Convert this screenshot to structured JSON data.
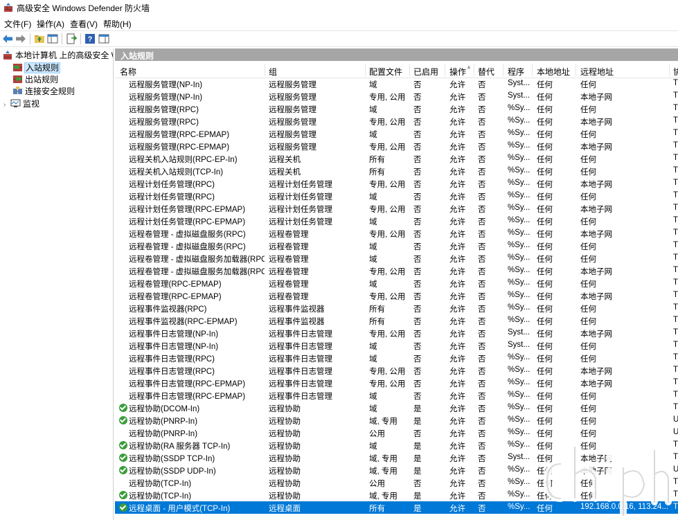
{
  "window": {
    "title": "高级安全 Windows Defender 防火墙"
  },
  "menu": [
    "文件(F)",
    "操作(A)",
    "查看(V)",
    "帮助(H)"
  ],
  "tree": [
    {
      "label": "本地计算机 上的高级安全 Wind"
    },
    {
      "label": "入站规则"
    },
    {
      "label": "出站规则"
    },
    {
      "label": "连接安全规则"
    },
    {
      "label": "监视"
    }
  ],
  "panel": {
    "title": "入站规则"
  },
  "columns": [
    "名称",
    "组",
    "配置文件",
    "已启用",
    "操作",
    "替代",
    "程序",
    "本地地址",
    "远程地址",
    "协"
  ],
  "rows": [
    {
      "name": "远程服务管理(NP-In)",
      "group": "远程服务管理",
      "profile": "域",
      "enabled": "否",
      "action": "允许",
      "override": "否",
      "program": "Syst...",
      "local": "任何",
      "remote": "任何",
      "more": "T",
      "on": false
    },
    {
      "name": "远程服务管理(NP-In)",
      "group": "远程服务管理",
      "profile": "专用, 公用",
      "enabled": "否",
      "action": "允许",
      "override": "否",
      "program": "Syst...",
      "local": "任何",
      "remote": "本地子网",
      "more": "T",
      "on": false
    },
    {
      "name": "远程服务管理(RPC)",
      "group": "远程服务管理",
      "profile": "域",
      "enabled": "否",
      "action": "允许",
      "override": "否",
      "program": "%Sy...",
      "local": "任何",
      "remote": "任何",
      "more": "T",
      "on": false
    },
    {
      "name": "远程服务管理(RPC)",
      "group": "远程服务管理",
      "profile": "专用, 公用",
      "enabled": "否",
      "action": "允许",
      "override": "否",
      "program": "%Sy...",
      "local": "任何",
      "remote": "本地子网",
      "more": "T",
      "on": false
    },
    {
      "name": "远程服务管理(RPC-EPMAP)",
      "group": "远程服务管理",
      "profile": "域",
      "enabled": "否",
      "action": "允许",
      "override": "否",
      "program": "%Sy...",
      "local": "任何",
      "remote": "任何",
      "more": "T",
      "on": false
    },
    {
      "name": "远程服务管理(RPC-EPMAP)",
      "group": "远程服务管理",
      "profile": "专用, 公用",
      "enabled": "否",
      "action": "允许",
      "override": "否",
      "program": "%Sy...",
      "local": "任何",
      "remote": "本地子网",
      "more": "T",
      "on": false
    },
    {
      "name": "远程关机入站规则(RPC-EP-In)",
      "group": "远程关机",
      "profile": "所有",
      "enabled": "否",
      "action": "允许",
      "override": "否",
      "program": "%Sy...",
      "local": "任何",
      "remote": "任何",
      "more": "T",
      "on": false
    },
    {
      "name": "远程关机入站规则(TCP-In)",
      "group": "远程关机",
      "profile": "所有",
      "enabled": "否",
      "action": "允许",
      "override": "否",
      "program": "%Sy...",
      "local": "任何",
      "remote": "任何",
      "more": "T",
      "on": false
    },
    {
      "name": "远程计划任务管理(RPC)",
      "group": "远程计划任务管理",
      "profile": "专用, 公用",
      "enabled": "否",
      "action": "允许",
      "override": "否",
      "program": "%Sy...",
      "local": "任何",
      "remote": "本地子网",
      "more": "T",
      "on": false
    },
    {
      "name": "远程计划任务管理(RPC)",
      "group": "远程计划任务管理",
      "profile": "域",
      "enabled": "否",
      "action": "允许",
      "override": "否",
      "program": "%Sy...",
      "local": "任何",
      "remote": "任何",
      "more": "T",
      "on": false
    },
    {
      "name": "远程计划任务管理(RPC-EPMAP)",
      "group": "远程计划任务管理",
      "profile": "专用, 公用",
      "enabled": "否",
      "action": "允许",
      "override": "否",
      "program": "%Sy...",
      "local": "任何",
      "remote": "本地子网",
      "more": "T",
      "on": false
    },
    {
      "name": "远程计划任务管理(RPC-EPMAP)",
      "group": "远程计划任务管理",
      "profile": "域",
      "enabled": "否",
      "action": "允许",
      "override": "否",
      "program": "%Sy...",
      "local": "任何",
      "remote": "任何",
      "more": "T",
      "on": false
    },
    {
      "name": "远程卷管理 - 虚拟磁盘服务(RPC)",
      "group": "远程卷管理",
      "profile": "专用, 公用",
      "enabled": "否",
      "action": "允许",
      "override": "否",
      "program": "%Sy...",
      "local": "任何",
      "remote": "本地子网",
      "more": "T",
      "on": false
    },
    {
      "name": "远程卷管理 - 虚拟磁盘服务(RPC)",
      "group": "远程卷管理",
      "profile": "域",
      "enabled": "否",
      "action": "允许",
      "override": "否",
      "program": "%Sy...",
      "local": "任何",
      "remote": "任何",
      "more": "T",
      "on": false
    },
    {
      "name": "远程卷管理 - 虚拟磁盘服务加载器(RPC)",
      "group": "远程卷管理",
      "profile": "域",
      "enabled": "否",
      "action": "允许",
      "override": "否",
      "program": "%Sy...",
      "local": "任何",
      "remote": "任何",
      "more": "T",
      "on": false
    },
    {
      "name": "远程卷管理 - 虚拟磁盘服务加载器(RPC)",
      "group": "远程卷管理",
      "profile": "专用, 公用",
      "enabled": "否",
      "action": "允许",
      "override": "否",
      "program": "%Sy...",
      "local": "任何",
      "remote": "本地子网",
      "more": "T",
      "on": false
    },
    {
      "name": "远程卷管理(RPC-EPMAP)",
      "group": "远程卷管理",
      "profile": "域",
      "enabled": "否",
      "action": "允许",
      "override": "否",
      "program": "%Sy...",
      "local": "任何",
      "remote": "任何",
      "more": "T",
      "on": false
    },
    {
      "name": "远程卷管理(RPC-EPMAP)",
      "group": "远程卷管理",
      "profile": "专用, 公用",
      "enabled": "否",
      "action": "允许",
      "override": "否",
      "program": "%Sy...",
      "local": "任何",
      "remote": "本地子网",
      "more": "T",
      "on": false
    },
    {
      "name": "远程事件监视器(RPC)",
      "group": "远程事件监视器",
      "profile": "所有",
      "enabled": "否",
      "action": "允许",
      "override": "否",
      "program": "%Sy...",
      "local": "任何",
      "remote": "任何",
      "more": "T",
      "on": false
    },
    {
      "name": "远程事件监视器(RPC-EPMAP)",
      "group": "远程事件监视器",
      "profile": "所有",
      "enabled": "否",
      "action": "允许",
      "override": "否",
      "program": "%Sy...",
      "local": "任何",
      "remote": "任何",
      "more": "T",
      "on": false
    },
    {
      "name": "远程事件日志管理(NP-In)",
      "group": "远程事件日志管理",
      "profile": "专用, 公用",
      "enabled": "否",
      "action": "允许",
      "override": "否",
      "program": "Syst...",
      "local": "任何",
      "remote": "本地子网",
      "more": "T",
      "on": false
    },
    {
      "name": "远程事件日志管理(NP-In)",
      "group": "远程事件日志管理",
      "profile": "域",
      "enabled": "否",
      "action": "允许",
      "override": "否",
      "program": "Syst...",
      "local": "任何",
      "remote": "任何",
      "more": "T",
      "on": false
    },
    {
      "name": "远程事件日志管理(RPC)",
      "group": "远程事件日志管理",
      "profile": "域",
      "enabled": "否",
      "action": "允许",
      "override": "否",
      "program": "%Sy...",
      "local": "任何",
      "remote": "任何",
      "more": "T",
      "on": false
    },
    {
      "name": "远程事件日志管理(RPC)",
      "group": "远程事件日志管理",
      "profile": "专用, 公用",
      "enabled": "否",
      "action": "允许",
      "override": "否",
      "program": "%Sy...",
      "local": "任何",
      "remote": "本地子网",
      "more": "T",
      "on": false
    },
    {
      "name": "远程事件日志管理(RPC-EPMAP)",
      "group": "远程事件日志管理",
      "profile": "专用, 公用",
      "enabled": "否",
      "action": "允许",
      "override": "否",
      "program": "%Sy...",
      "local": "任何",
      "remote": "本地子网",
      "more": "T",
      "on": false
    },
    {
      "name": "远程事件日志管理(RPC-EPMAP)",
      "group": "远程事件日志管理",
      "profile": "域",
      "enabled": "否",
      "action": "允许",
      "override": "否",
      "program": "%Sy...",
      "local": "任何",
      "remote": "任何",
      "more": "T",
      "on": false
    },
    {
      "name": "远程协助(DCOM-In)",
      "group": "远程协助",
      "profile": "域",
      "enabled": "是",
      "action": "允许",
      "override": "否",
      "program": "%Sy...",
      "local": "任何",
      "remote": "任何",
      "more": "T",
      "on": true
    },
    {
      "name": "远程协助(PNRP-In)",
      "group": "远程协助",
      "profile": "域, 专用",
      "enabled": "是",
      "action": "允许",
      "override": "否",
      "program": "%Sy...",
      "local": "任何",
      "remote": "任何",
      "more": "U",
      "on": true
    },
    {
      "name": "远程协助(PNRP-In)",
      "group": "远程协助",
      "profile": "公用",
      "enabled": "否",
      "action": "允许",
      "override": "否",
      "program": "%Sy...",
      "local": "任何",
      "remote": "任何",
      "more": "U",
      "on": false
    },
    {
      "name": "远程协助(RA 服务器 TCP-In)",
      "group": "远程协助",
      "profile": "域",
      "enabled": "是",
      "action": "允许",
      "override": "否",
      "program": "%Sy...",
      "local": "任何",
      "remote": "任何",
      "more": "T",
      "on": true
    },
    {
      "name": "远程协助(SSDP TCP-In)",
      "group": "远程协助",
      "profile": "域, 专用",
      "enabled": "是",
      "action": "允许",
      "override": "否",
      "program": "Syst...",
      "local": "任何",
      "remote": "本地子网",
      "more": "T",
      "on": true
    },
    {
      "name": "远程协助(SSDP UDP-In)",
      "group": "远程协助",
      "profile": "域, 专用",
      "enabled": "是",
      "action": "允许",
      "override": "否",
      "program": "%Sy...",
      "local": "任何",
      "remote": "本地子网",
      "more": "U",
      "on": true
    },
    {
      "name": "远程协助(TCP-In)",
      "group": "远程协助",
      "profile": "公用",
      "enabled": "否",
      "action": "允许",
      "override": "否",
      "program": "%Sy...",
      "local": "任何",
      "remote": "任何",
      "more": "T",
      "on": false
    },
    {
      "name": "远程协助(TCP-In)",
      "group": "远程协助",
      "profile": "域, 专用",
      "enabled": "是",
      "action": "允许",
      "override": "否",
      "program": "%Sy...",
      "local": "任何",
      "remote": "任何",
      "more": "T",
      "on": true
    },
    {
      "name": "远程桌面 - 用户模式(TCP-In)",
      "group": "远程桌面",
      "profile": "所有",
      "enabled": "是",
      "action": "允许",
      "override": "否",
      "program": "%Sy...",
      "local": "任何",
      "remote": "192.168.0.0/16, 113.24...",
      "more": "T",
      "on": true,
      "selected": true
    }
  ]
}
